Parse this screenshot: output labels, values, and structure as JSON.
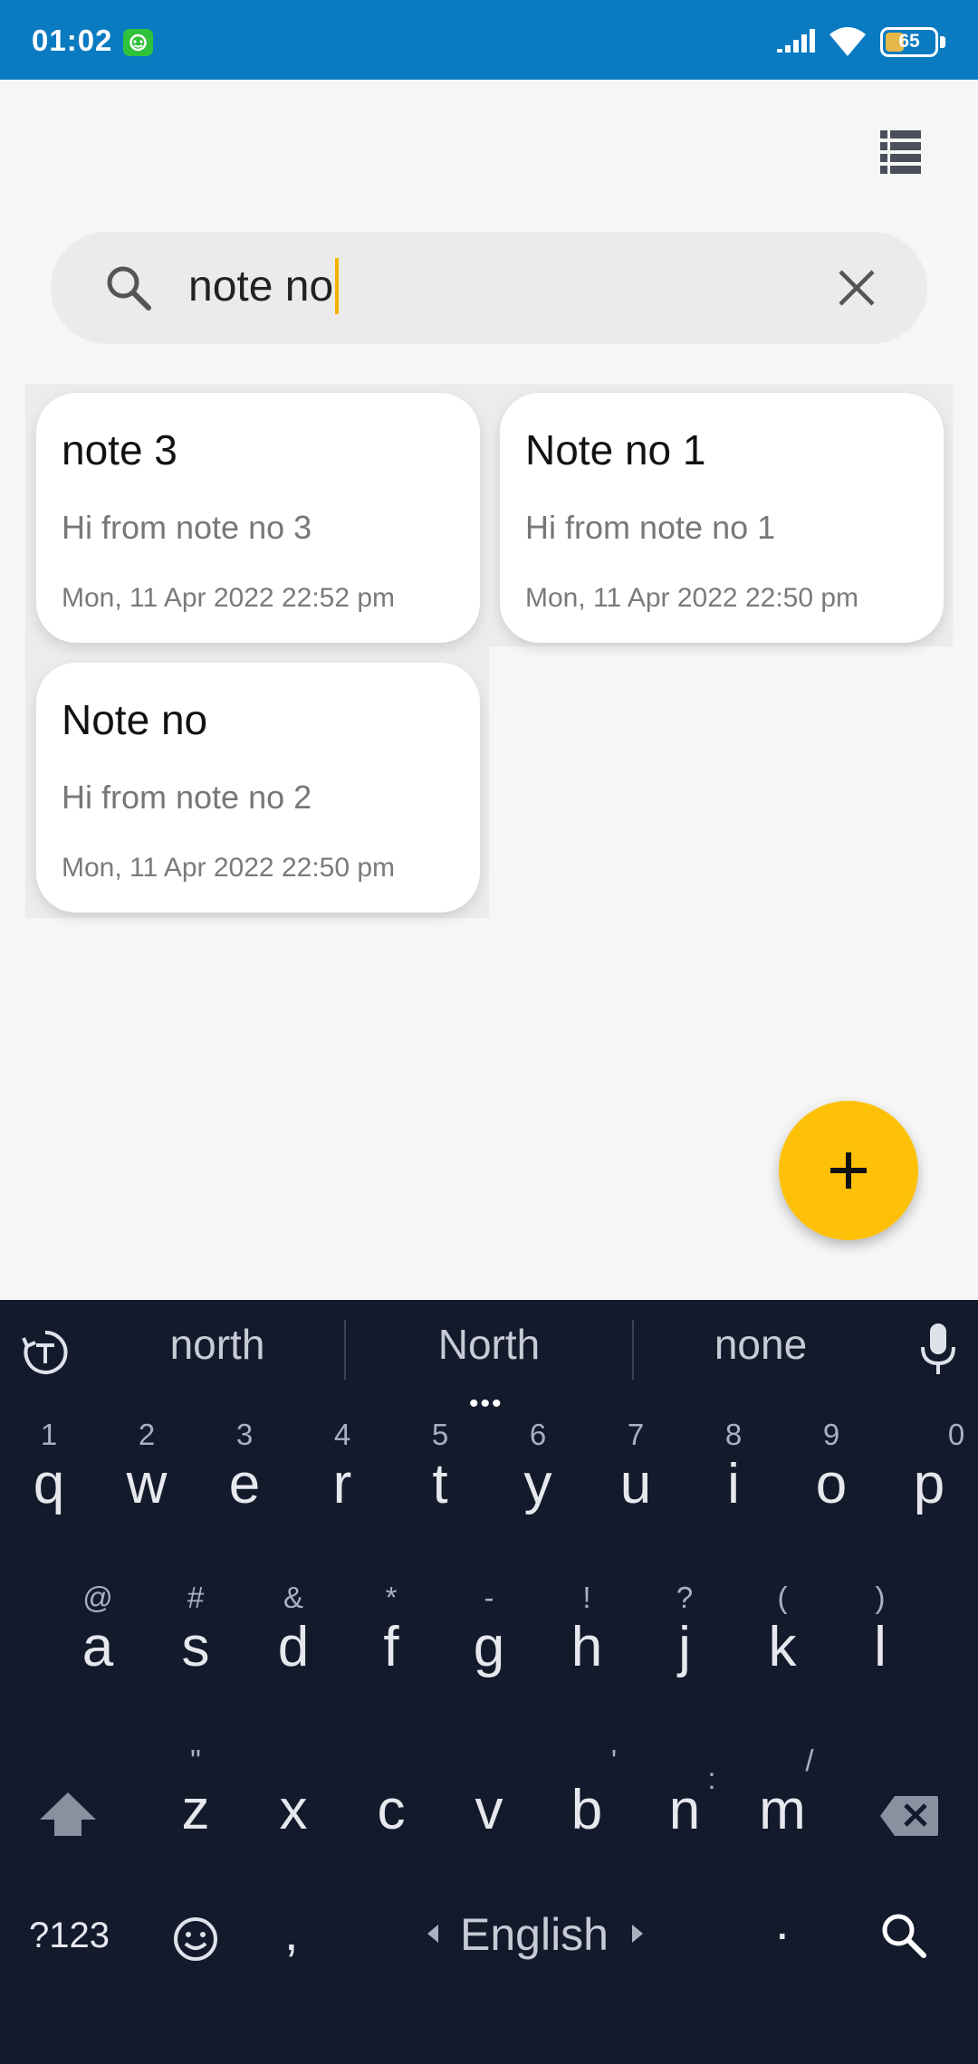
{
  "status_bar": {
    "time": "01:02",
    "battery": "65",
    "icons": [
      "app-notification-icon",
      "signal-icon",
      "wifi-icon",
      "battery-icon"
    ]
  },
  "toolbar": {
    "view_toggle_icon": "list-view-icon"
  },
  "search": {
    "value": "note no",
    "search_icon": "search-icon",
    "clear_icon": "close-icon"
  },
  "notes": [
    {
      "title": "note 3",
      "body": "Hi from note no 3",
      "date": "Mon, 11 Apr 2022 22:52 pm"
    },
    {
      "title": "Note no 1",
      "body": "Hi from note no 1",
      "date": "Mon, 11 Apr 2022 22:50 pm"
    },
    {
      "title": "Note no",
      "body": "Hi from note no 2",
      "date": "Mon, 11 Apr 2022 22:50 pm"
    }
  ],
  "fab": {
    "icon": "plus-icon",
    "color": "#ffc107"
  },
  "keyboard": {
    "suggestions": [
      "north",
      "North",
      "none"
    ],
    "more_indicator": "•••",
    "row1": [
      {
        "key": "q",
        "hint": "1"
      },
      {
        "key": "w",
        "hint": "2"
      },
      {
        "key": "e",
        "hint": "3"
      },
      {
        "key": "r",
        "hint": "4"
      },
      {
        "key": "t",
        "hint": "5"
      },
      {
        "key": "y",
        "hint": "6"
      },
      {
        "key": "u",
        "hint": "7"
      },
      {
        "key": "i",
        "hint": "8"
      },
      {
        "key": "o",
        "hint": "9"
      },
      {
        "key": "p",
        "hint": "0"
      }
    ],
    "row2": [
      {
        "key": "a",
        "hint": "@"
      },
      {
        "key": "s",
        "hint": "#"
      },
      {
        "key": "d",
        "hint": "&"
      },
      {
        "key": "f",
        "hint": "*"
      },
      {
        "key": "g",
        "hint": "-"
      },
      {
        "key": "h",
        "hint": "!"
      },
      {
        "key": "j",
        "hint": "?"
      },
      {
        "key": "k",
        "hint": "("
      },
      {
        "key": "l",
        "hint": ")"
      }
    ],
    "row3": [
      {
        "key": "z",
        "hint": "\""
      },
      {
        "key": "x",
        "hint": ""
      },
      {
        "key": "c",
        "hint": ""
      },
      {
        "key": "v",
        "hint": ""
      },
      {
        "key": "b",
        "hint": "'"
      },
      {
        "key": "n",
        "hint": ":"
      },
      {
        "key": "m",
        "hint": "/"
      }
    ],
    "symbols_label": "?123",
    "comma": ",",
    "space_label": "English",
    "period": ".",
    "background": "#131a2b"
  }
}
